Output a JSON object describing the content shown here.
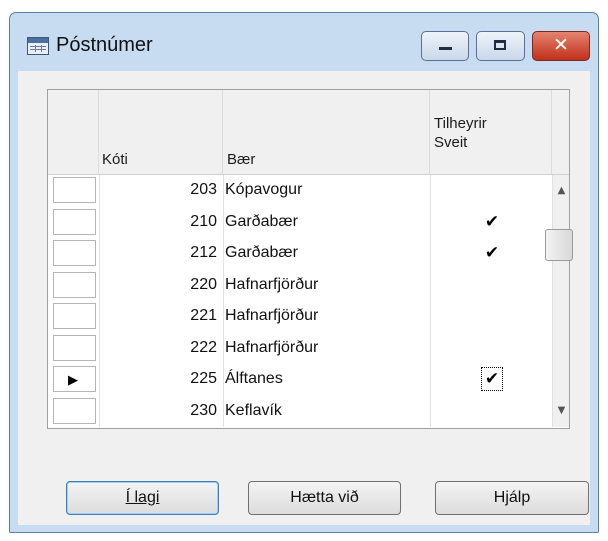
{
  "window": {
    "title": "Póstnúmer"
  },
  "titlebar_buttons": {
    "minimize": "minimize",
    "maximize": "maximize",
    "close": "✕"
  },
  "table": {
    "headers": {
      "koti": "Kóti",
      "baer": "Bær",
      "sveit_line1": "Tilheyrir",
      "sveit_line2": "Sveit"
    },
    "rows": [
      {
        "koti": "203",
        "baer": "Kópavogur",
        "sveit": false,
        "current": false
      },
      {
        "koti": "210",
        "baer": "Garðabær",
        "sveit": true,
        "current": false
      },
      {
        "koti": "212",
        "baer": "Garðabær",
        "sveit": true,
        "current": false
      },
      {
        "koti": "220",
        "baer": "Hafnarfjörður",
        "sveit": false,
        "current": false
      },
      {
        "koti": "221",
        "baer": "Hafnarfjörður",
        "sveit": false,
        "current": false
      },
      {
        "koti": "222",
        "baer": "Hafnarfjörður",
        "sveit": false,
        "current": false
      },
      {
        "koti": "225",
        "baer": "Álftanes",
        "sveit": true,
        "current": true
      },
      {
        "koti": "230",
        "baer": "Keflavík",
        "sveit": false,
        "current": false
      }
    ],
    "check_glyph": "✔",
    "current_row_glyph": "▶"
  },
  "scrollbar": {
    "up_glyph": "▲",
    "down_glyph": "▼"
  },
  "buttons": {
    "ok": "Í lagi",
    "cancel": "Hætta við",
    "help": "Hjálp"
  }
}
